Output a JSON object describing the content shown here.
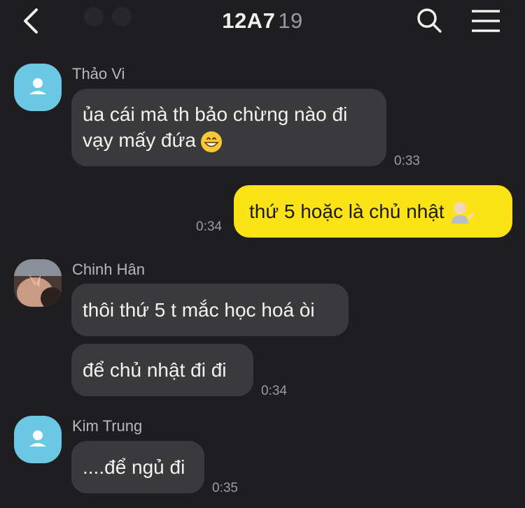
{
  "header": {
    "title": "12A7",
    "member_count": "19",
    "back_icon": "back-chevron-icon",
    "search_icon": "search-icon",
    "menu_icon": "menu-icon"
  },
  "messages": [
    {
      "sender": "Thảo Vi",
      "lines": [
        "ủa cái mà th bảo chừng nào đi",
        "vạy mấy đứa"
      ],
      "emoji": "grinning-face-emoji",
      "time": "0:33",
      "outgoing": false
    },
    {
      "lines": [
        "thứ 5 hoặc là chủ nhật"
      ],
      "emoji": "person-tipping-hand-emoji",
      "time": "0:34",
      "outgoing": true
    },
    {
      "sender": "Chinh Hân",
      "lines": [
        "thôi thứ 5 t mắc học hoá òi"
      ],
      "outgoing": false
    },
    {
      "lines": [
        "để chủ nhật đi đi"
      ],
      "time": "0:34",
      "outgoing": false
    },
    {
      "sender": "Kim Trung",
      "lines": [
        "....để ngủ đi"
      ],
      "time": "0:35",
      "outgoing": false
    }
  ],
  "colors": {
    "background": "#1e1e20",
    "incoming_bubble": "#3a3a3d",
    "outgoing_bubble": "#fbe318",
    "default_avatar": "#6cc7e4"
  }
}
